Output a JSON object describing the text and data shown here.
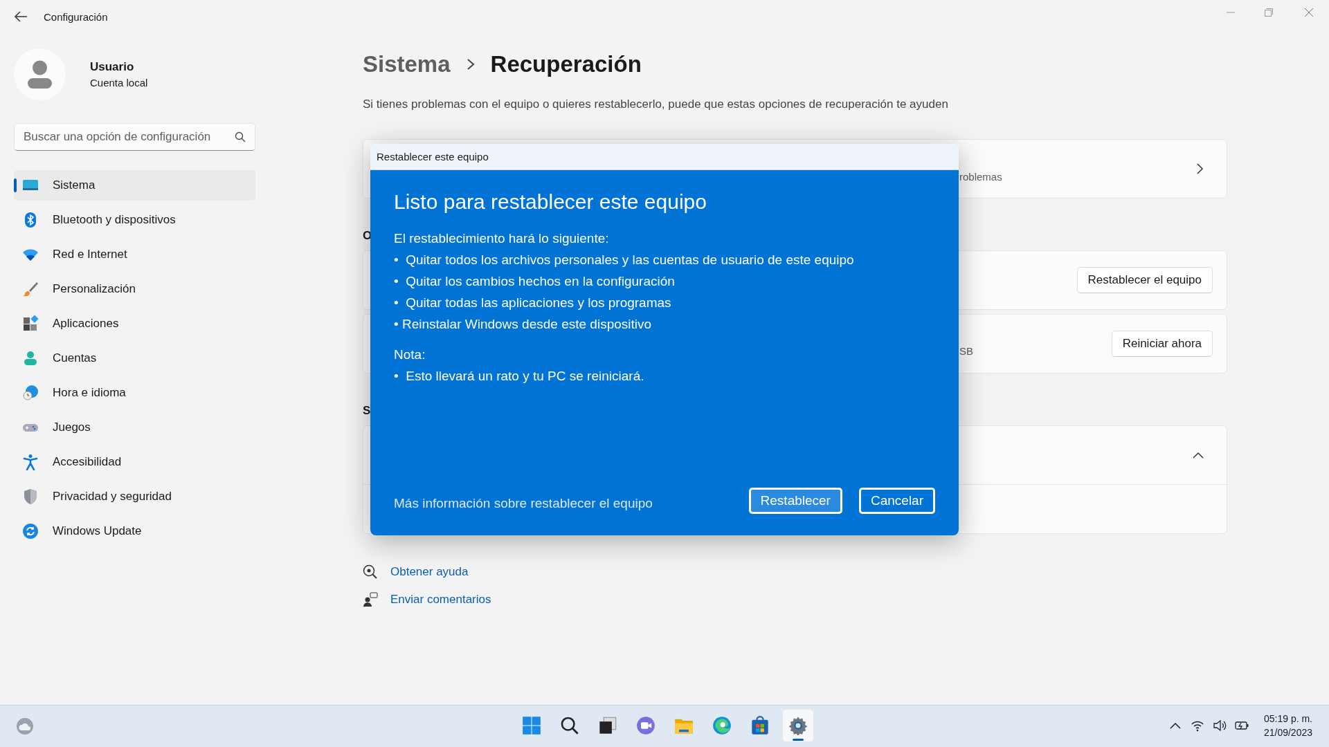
{
  "window": {
    "title": "Configuración"
  },
  "user": {
    "name": "Usuario",
    "account": "Cuenta local"
  },
  "search": {
    "placeholder": "Buscar una opción de configuración"
  },
  "nav": [
    {
      "label": "Sistema",
      "kind": "system",
      "selected": true
    },
    {
      "label": "Bluetooth y dispositivos",
      "kind": "bluetooth",
      "selected": false
    },
    {
      "label": "Red e Internet",
      "kind": "wifi",
      "selected": false
    },
    {
      "label": "Personalización",
      "kind": "brush",
      "selected": false
    },
    {
      "label": "Aplicaciones",
      "kind": "apps",
      "selected": false
    },
    {
      "label": "Cuentas",
      "kind": "person",
      "selected": false
    },
    {
      "label": "Hora e idioma",
      "kind": "globe",
      "selected": false
    },
    {
      "label": "Juegos",
      "kind": "gamepad",
      "selected": false
    },
    {
      "label": "Accesibilidad",
      "kind": "accessibility",
      "selected": false
    },
    {
      "label": "Privacidad y seguridad",
      "kind": "shield",
      "selected": false
    },
    {
      "label": "Windows Update",
      "kind": "update",
      "selected": false
    }
  ],
  "breadcrumb": {
    "parent": "Sistema",
    "current": "Recuperación"
  },
  "description": "Si tienes problemas con el equipo o quieres restablecerlo, puede que estas opciones de recuperación te ayuden",
  "sections": [
    {
      "cards": [
        {
          "kind": "link",
          "subtitle": "roblemas"
        }
      ]
    },
    {
      "heading": "O",
      "cards": [
        {
          "kind": "button",
          "button": "Restablecer el equipo"
        },
        {
          "kind": "button",
          "subtitle": "SB",
          "button": "Reiniciar ahora"
        }
      ]
    },
    {
      "heading": "S",
      "cards": [
        {
          "kind": "expander",
          "expanded": true
        }
      ]
    }
  ],
  "help_links": [
    {
      "label": "Obtener ayuda",
      "kind": "help"
    },
    {
      "label": "Enviar comentarios",
      "kind": "feedback"
    }
  ],
  "dialog": {
    "title": "Restablecer este equipo",
    "heading": "Listo para restablecer este equipo",
    "intro": "El restablecimiento hará lo siguiente:",
    "items": [
      "•  Quitar todos los archivos personales y las cuentas de usuario de este equipo",
      "•  Quitar los cambios hechos en la configuración",
      "•  Quitar todas las aplicaciones y los programas",
      "• Reinstalar Windows desde este dispositivo"
    ],
    "note_label": "Nota:",
    "notes": [
      "•  Esto llevará un rato y tu PC se reiniciará."
    ],
    "link": "Más información sobre restablecer el equipo",
    "buttons": [
      {
        "label": "Restablecer",
        "selected": true
      },
      {
        "label": "Cancelar",
        "selected": false
      }
    ]
  },
  "taskbar": {
    "apps": [
      {
        "kind": "start",
        "selected": false
      },
      {
        "kind": "search",
        "selected": false
      },
      {
        "kind": "taskview",
        "selected": false
      },
      {
        "kind": "chat",
        "selected": false
      },
      {
        "kind": "explorer",
        "selected": false
      },
      {
        "kind": "edge",
        "selected": false
      },
      {
        "kind": "store",
        "selected": false
      },
      {
        "kind": "settings",
        "selected": true
      }
    ],
    "time": "05:19 p. m.",
    "date": "21/09/2023"
  }
}
